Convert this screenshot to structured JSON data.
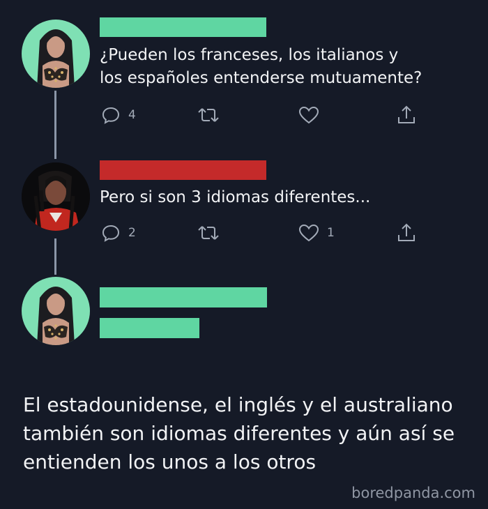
{
  "tweets": [
    {
      "text": "¿Pueden los franceses, los italianos y\nlos españoles entenderse mutuamente?",
      "reply_count": "4",
      "retweet_count": "",
      "like_count": ""
    },
    {
      "text": "Pero si son 3 idiomas diferentes...",
      "reply_count": "2",
      "retweet_count": "",
      "like_count": "1"
    },
    {
      "text": ""
    }
  ],
  "caption": "El estadounidense, el inglés y el australiano también son idiomas diferentes y aún así se entienden los unos a los otros",
  "watermark": "boredpanda.com",
  "colors": {
    "background": "#151a27",
    "redaction_green": "#5fd6a2",
    "redaction_red": "#c42a2a",
    "avatar_mint": "#7fe0b4",
    "icon_gray": "#a3abb8"
  },
  "icons": [
    "reply-icon",
    "retweet-icon",
    "like-icon",
    "share-icon"
  ]
}
